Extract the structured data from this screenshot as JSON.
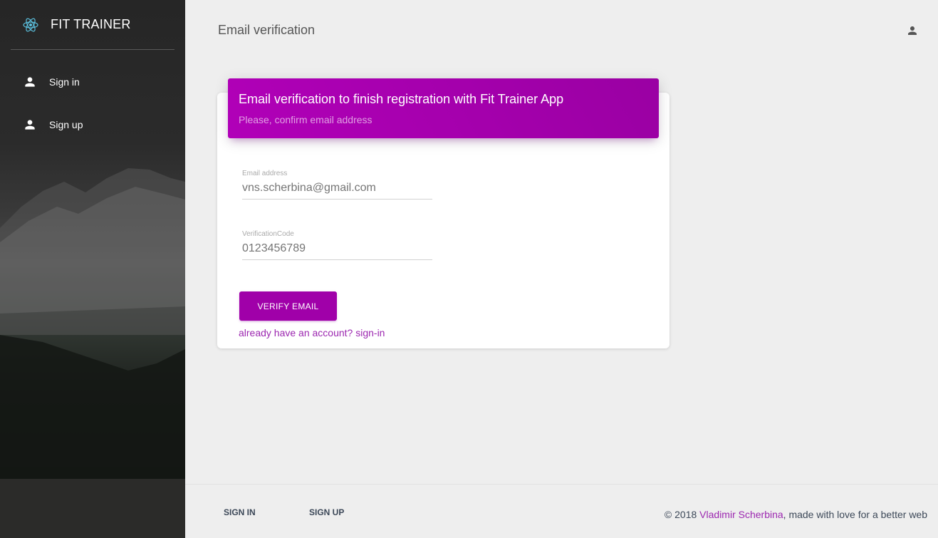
{
  "sidebar": {
    "brand": "FIT TRAINER",
    "items": [
      {
        "label": "Sign in"
      },
      {
        "label": "Sign up"
      }
    ]
  },
  "header": {
    "title": "Email verification"
  },
  "card": {
    "title": "Email verification to finish registration with Fit Trainer App",
    "subtitle": "Please, confirm email address",
    "email": {
      "label": "Email address",
      "placeholder": "vns.scherbina@gmail.com"
    },
    "code": {
      "label": "VerificationCode",
      "placeholder": "0123456789"
    },
    "verify_button": "VERIFY EMAIL",
    "signin_link": "already have an account? sign-in"
  },
  "footer": {
    "links": [
      "SIGN IN",
      "SIGN UP"
    ],
    "copyright_prefix": "© 2018",
    "author": "Vladimir Scherbina",
    "copyright_suffix": ", made with love for a better web"
  },
  "colors": {
    "accent": "#9c27b0",
    "header_gradient": "#a000a9"
  },
  "icons": {
    "brand": "react-atom-icon",
    "nav": "person-icon",
    "header": "person-icon"
  }
}
